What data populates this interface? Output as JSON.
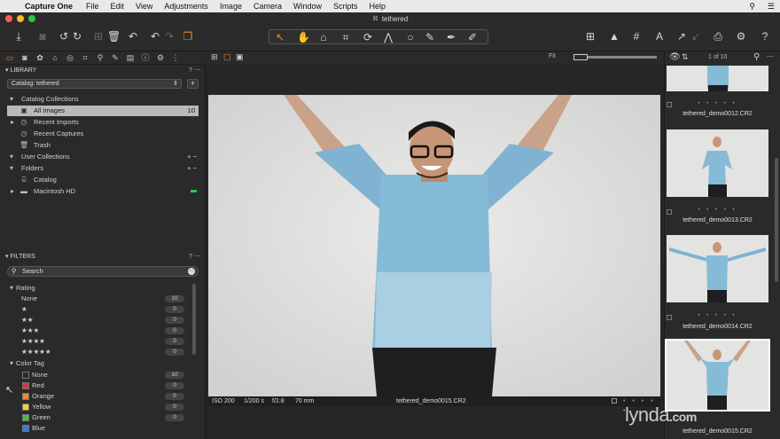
{
  "menubar": {
    "app_name": "Capture One",
    "items": [
      "File",
      "Edit",
      "View",
      "Adjustments",
      "Image",
      "Camera",
      "Window",
      "Scripts",
      "Help"
    ]
  },
  "window": {
    "title": "tethered"
  },
  "library": {
    "header": "LIBRARY",
    "help": "?",
    "catalog_value": "Catalog: tethered",
    "catalog_collections_label": "Catalog Collections",
    "all_images_label": "All Images",
    "all_images_count": "10",
    "recent_imports_label": "Recent Imports",
    "recent_captures_label": "Recent Captures",
    "trash_label": "Trash",
    "user_collections_label": "User Collections",
    "folders_label": "Folders",
    "catalog_folder_label": "Catalog",
    "macintosh_hd_label": "Macintosh HD"
  },
  "filters": {
    "header": "FILTERS",
    "help": "?",
    "search_placeholder": "Search",
    "rating_label": "Rating",
    "ratings": [
      {
        "label": "None",
        "count": "10"
      },
      {
        "label": "★",
        "count": "0"
      },
      {
        "label": "★★",
        "count": "0"
      },
      {
        "label": "★★★",
        "count": "0"
      },
      {
        "label": "★★★★",
        "count": "0"
      },
      {
        "label": "★★★★★",
        "count": "0"
      }
    ],
    "color_tag_label": "Color Tag",
    "color_tags": [
      {
        "label": "None",
        "count": "10",
        "color": "#2a2a2a"
      },
      {
        "label": "Red",
        "count": "0",
        "color": "#e0312f"
      },
      {
        "label": "Orange",
        "count": "0",
        "color": "#f08a24"
      },
      {
        "label": "Yellow",
        "count": "0",
        "color": "#f2d22e"
      },
      {
        "label": "Green",
        "count": "0",
        "color": "#3cc43c"
      },
      {
        "label": "Blue",
        "count": "",
        "color": "#2f7de0"
      }
    ]
  },
  "viewer": {
    "fit_label": "Fit",
    "iso": "ISO 200",
    "shutter": "1/200 s",
    "aperture": "f/2.8",
    "focal": "70 mm",
    "filename": "tethered_demo0015.CR2"
  },
  "browser": {
    "counter": "1 of 10",
    "thumbs": [
      {
        "name": "tethered_demo0012.CR2"
      },
      {
        "name": "tethered_demo0013.CR2"
      },
      {
        "name": "tethered_demo0014.CR2"
      },
      {
        "name": "tethered_demo0015.CR2"
      }
    ]
  },
  "watermark": {
    "text": "lynda",
    "suffix": ".com"
  }
}
